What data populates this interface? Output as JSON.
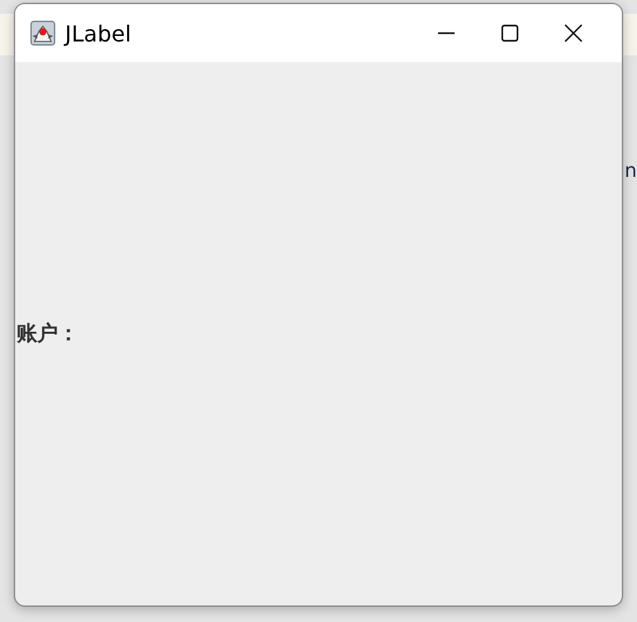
{
  "background": {
    "text": "n"
  },
  "window": {
    "title": "JLabel",
    "controls": [
      {
        "kind": "minimize"
      },
      {
        "kind": "maximize"
      },
      {
        "kind": "close"
      }
    ]
  },
  "content": {
    "label": "账户："
  }
}
